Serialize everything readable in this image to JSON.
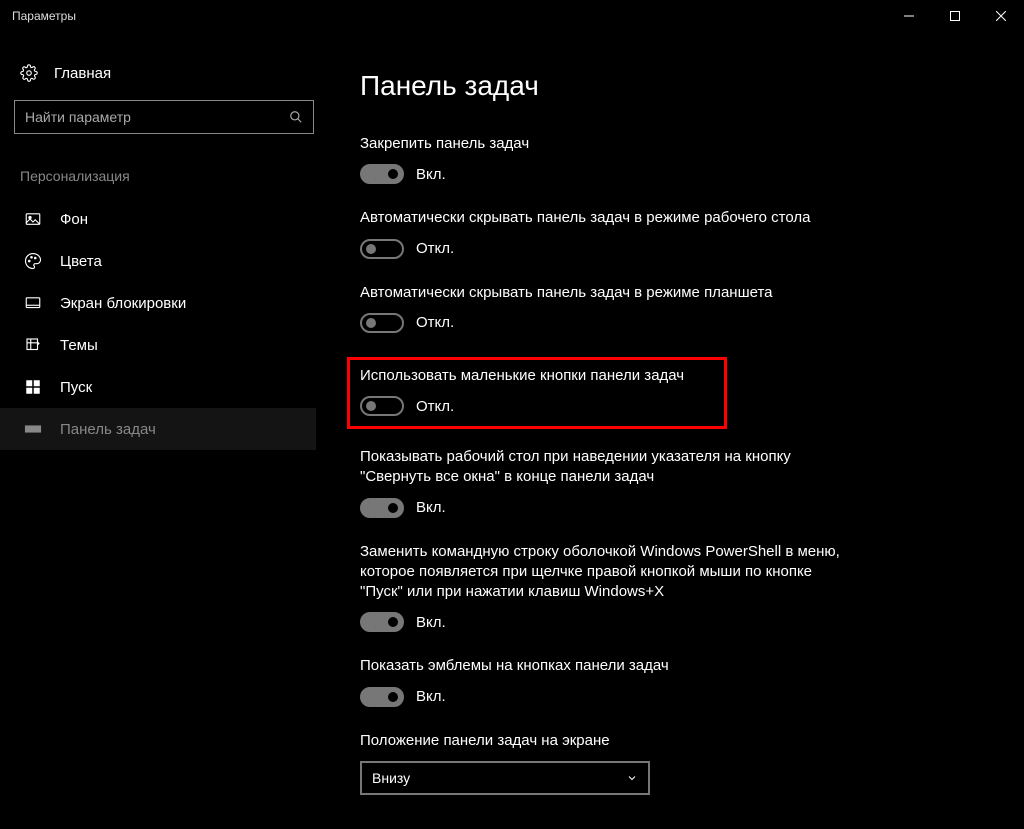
{
  "window": {
    "title": "Параметры"
  },
  "sidebar": {
    "home": "Главная",
    "search_placeholder": "Найти параметр",
    "category": "Персонализация",
    "items": [
      {
        "label": "Фон"
      },
      {
        "label": "Цвета"
      },
      {
        "label": "Экран блокировки"
      },
      {
        "label": "Темы"
      },
      {
        "label": "Пуск"
      },
      {
        "label": "Панель задач"
      }
    ]
  },
  "page": {
    "title": "Панель задач",
    "settings": [
      {
        "label": "Закрепить панель задач",
        "state": "Вкл.",
        "on": true
      },
      {
        "label": "Автоматически скрывать панель задач в режиме рабочего стола",
        "state": "Откл.",
        "on": false
      },
      {
        "label": "Автоматически скрывать панель задач в режиме планшета",
        "state": "Откл.",
        "on": false
      },
      {
        "label": "Использовать маленькие кнопки панели задач",
        "state": "Откл.",
        "on": false
      },
      {
        "label": "Показывать рабочий стол при наведении указателя на кнопку \"Свернуть все окна\" в конце панели задач",
        "state": "Вкл.",
        "on": true
      },
      {
        "label": "Заменить командную строку оболочкой Windows PowerShell в меню, которое появляется при щелчке правой кнопкой мыши по кнопке \"Пуск\" или при нажатии клавиш Windows+X",
        "state": "Вкл.",
        "on": true
      },
      {
        "label": "Показать эмблемы на кнопках панели задач",
        "state": "Вкл.",
        "on": true
      }
    ],
    "position": {
      "label": "Положение панели задач на экране",
      "value": "Внизу"
    }
  }
}
